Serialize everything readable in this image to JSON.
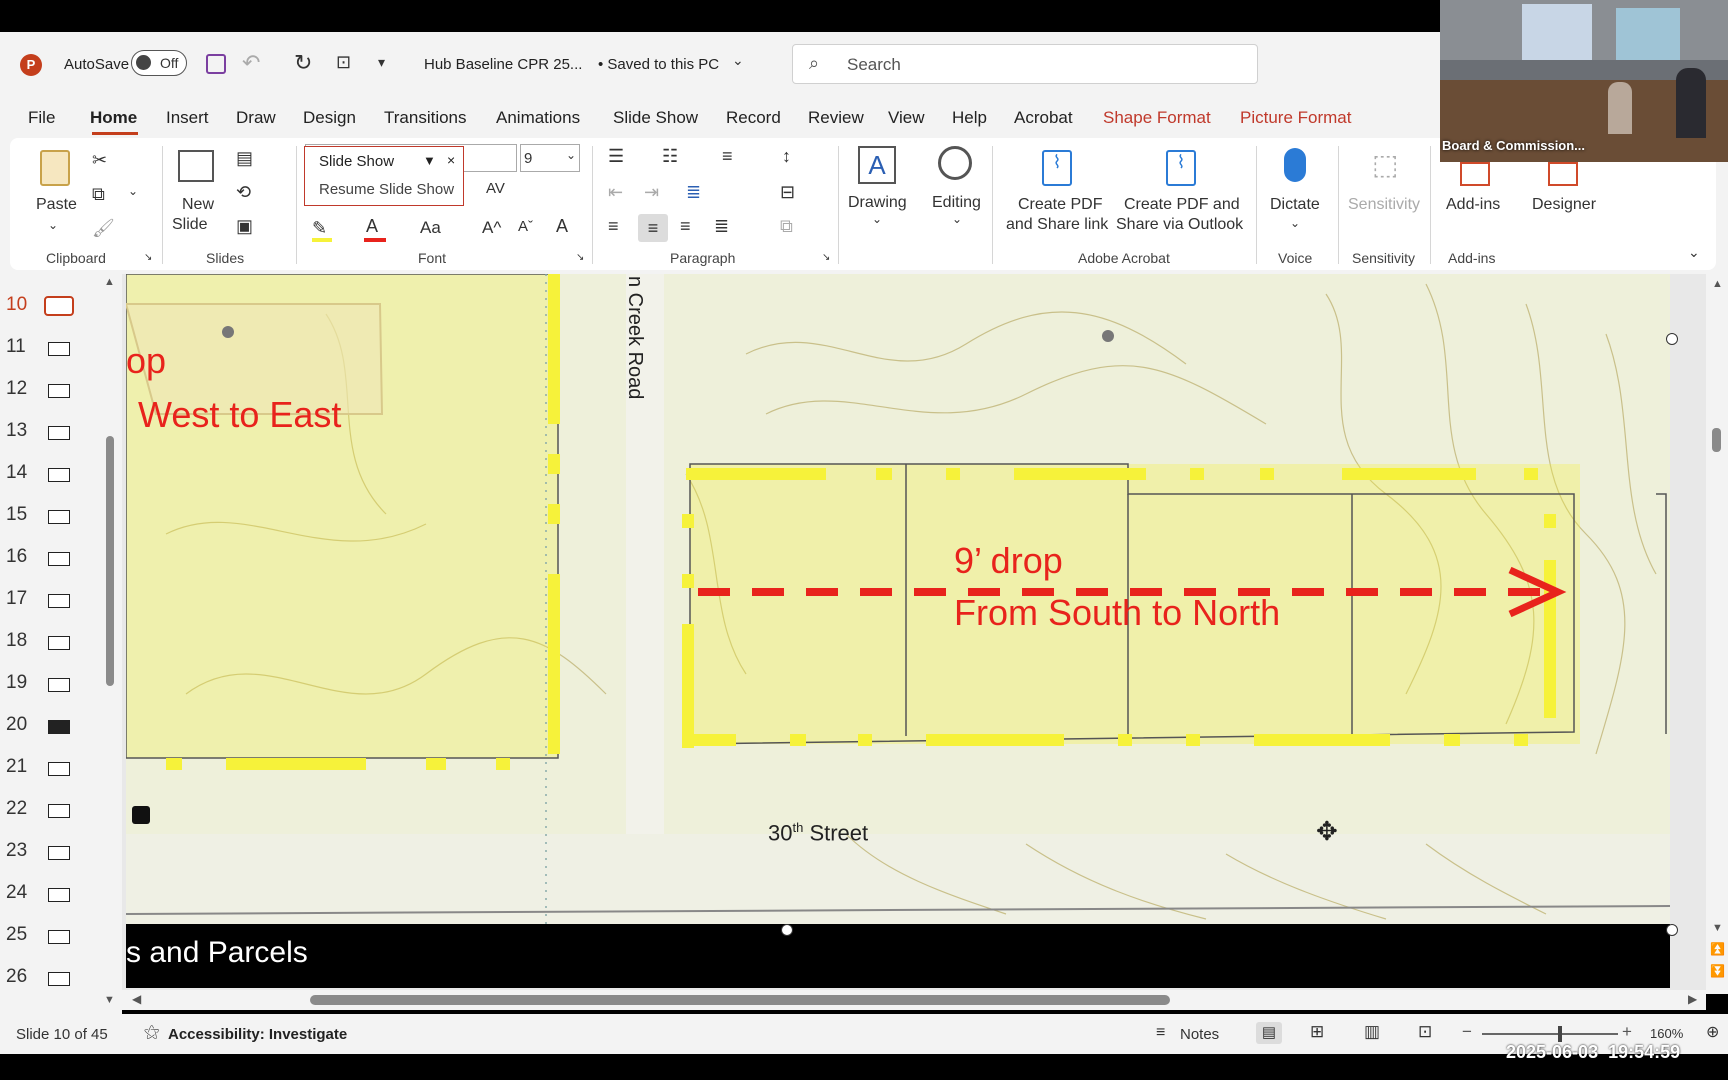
{
  "titlebar": {
    "autosave_label": "AutoSave",
    "autosave_state": "Off",
    "filename": "Hub Baseline CPR 25...",
    "save_status": "• Saved to this PC",
    "search_placeholder": "Search"
  },
  "menu_tabs": [
    "File",
    "Home",
    "Insert",
    "Draw",
    "Design",
    "Transitions",
    "Animations",
    "Slide Show",
    "Record",
    "Review",
    "View",
    "Help",
    "Acrobat",
    "Shape Format",
    "Picture Format"
  ],
  "active_tab": "Home",
  "ribbon": {
    "paste": "Paste",
    "new_slide_1": "New",
    "new_slide_2": "Slide",
    "font_name_value": "Slide Show",
    "font_size": "9",
    "resume_slideshow": "Resume Slide Show",
    "drawing": "Drawing",
    "editing": "Editing",
    "create_pdf_1": "Create PDF",
    "create_pdf_2": "and Share link",
    "create_pdf_outlook_1": "Create PDF and",
    "create_pdf_outlook_2": "Share via Outlook",
    "dictate": "Dictate",
    "sensitivity": "Sensitivity",
    "addins": "Add-ins",
    "designer": "Designer",
    "groups": {
      "clipboard": "Clipboard",
      "slides": "Slides",
      "font": "Font",
      "paragraph": "Paragraph",
      "adobe": "Adobe Acrobat",
      "voice": "Voice",
      "sensitivity": "Sensitivity",
      "addins": "Add-ins"
    }
  },
  "thumbnails": [
    "10",
    "11",
    "12",
    "13",
    "14",
    "15",
    "16",
    "17",
    "18",
    "19",
    "20",
    "21",
    "22",
    "23",
    "24",
    "25",
    "26"
  ],
  "slide": {
    "left_drop_partial": "op",
    "left_direction": "West to East",
    "road_label": "n Creek Road",
    "drop_label": "9’ drop",
    "drop_direction": "From South to North",
    "street_base": "30",
    "street_sup": "th",
    "street_name": " Street",
    "bottom_title": "s and Parcels"
  },
  "status": {
    "slide_count": "Slide 10 of 45",
    "accessibility": "Accessibility: Investigate",
    "notes": "Notes",
    "zoom": "160%"
  },
  "webcam": {
    "caption": "Board & Commission..."
  },
  "timestamp": "2025-06-03  19:54:59",
  "colors": {
    "brand": "#c43e1c",
    "ctx_tab": "#c0392b",
    "annotation_red": "#e8231c",
    "highlight_yellow": "#f6f23a"
  }
}
